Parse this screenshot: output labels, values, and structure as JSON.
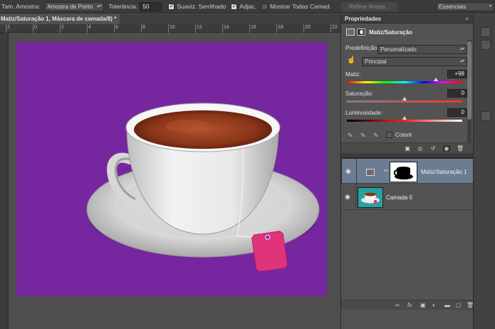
{
  "options_bar": {
    "sample_size_label": "Tam. Amostra:",
    "sample_size_value": "Amostra de Ponto",
    "tolerance_label": "Tolerância:",
    "tolerance_value": "50",
    "anti_alias_label": "Suaviz. Serrilhado",
    "anti_alias_checked": true,
    "contiguous_label": "Adjac.",
    "contiguous_checked": true,
    "sample_all_layers_label": "Mostrar Todas Camad.",
    "sample_all_layers_checked": false,
    "refine_edge_label": "Refinar Aresta...",
    "workspace_value": "Essenciais"
  },
  "document": {
    "tab_title": "Matiz/Saturação 1, Máscara de camada/8) *",
    "ruler_numbers": [
      "2",
      "0",
      "2",
      "4",
      "6",
      "8",
      "10",
      "12",
      "14",
      "16",
      "18",
      "20",
      "22"
    ]
  },
  "canvas": {
    "background_color": "#7627a0"
  },
  "properties": {
    "panel_title": "Propriedades",
    "adjustment_title": "Matiz/Saturação",
    "preset_label": "Predefinição:",
    "preset_value": "Personalizado",
    "channel_value": "Principal",
    "hue_label": "Matiz:",
    "hue_value": "+98",
    "hue_fraction": 0.77,
    "saturation_label": "Saturação:",
    "saturation_value": "0",
    "saturation_fraction": 0.5,
    "lightness_label": "Luminosidade:",
    "lightness_value": "0",
    "lightness_fraction": 0.5,
    "colorize_label": "Colorir",
    "colorize_checked": false
  },
  "layers": {
    "items": [
      {
        "name": "Matiz/Saturação 1",
        "selected": true,
        "visible": true
      },
      {
        "name": "Camada 0",
        "selected": false,
        "visible": true
      }
    ]
  },
  "icons": {
    "eye": "eye-icon",
    "link": "link-icon",
    "fx": "fx"
  }
}
